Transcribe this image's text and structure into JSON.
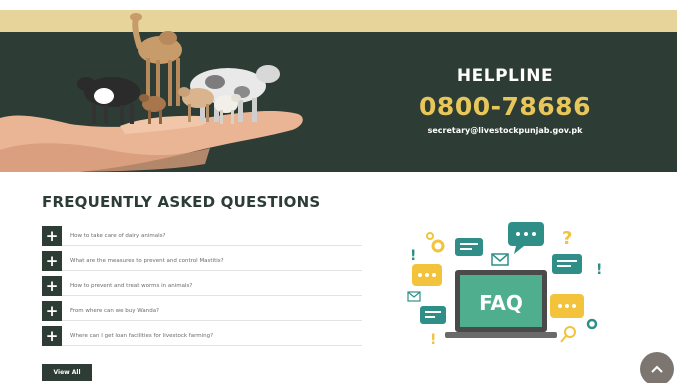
{
  "banner": {
    "helpline_title": "HELPLINE",
    "helpline_phone": "0800-78686",
    "helpline_email": "secretary@livestockpunjab.gov.pk"
  },
  "faq": {
    "heading": "FREQUENTLY ASKED QUESTIONS",
    "items": [
      {
        "question": "How to take care of dairy animals?"
      },
      {
        "question": "What are the measures to prevent and control Mastitis?"
      },
      {
        "question": "How to prevent and treat worms in animals?"
      },
      {
        "question": "From where can we buy Wanda?"
      },
      {
        "question": "Where can I get loan facilities for livestock farming?"
      }
    ],
    "view_all_label": "View All",
    "illustration_label": "FAQ"
  },
  "colors": {
    "banner_bg": "#2e3c36",
    "gold_band": "#e7d49a",
    "phone_accent": "#e8c65a",
    "faq_screen": "#4fae8e",
    "faq_bubble_teal": "#2f8f88",
    "faq_bubble_yellow": "#f2c33b"
  },
  "icons": {
    "faq_item_toggle": "plus-icon",
    "scroll_button": "chevron-up-icon"
  }
}
